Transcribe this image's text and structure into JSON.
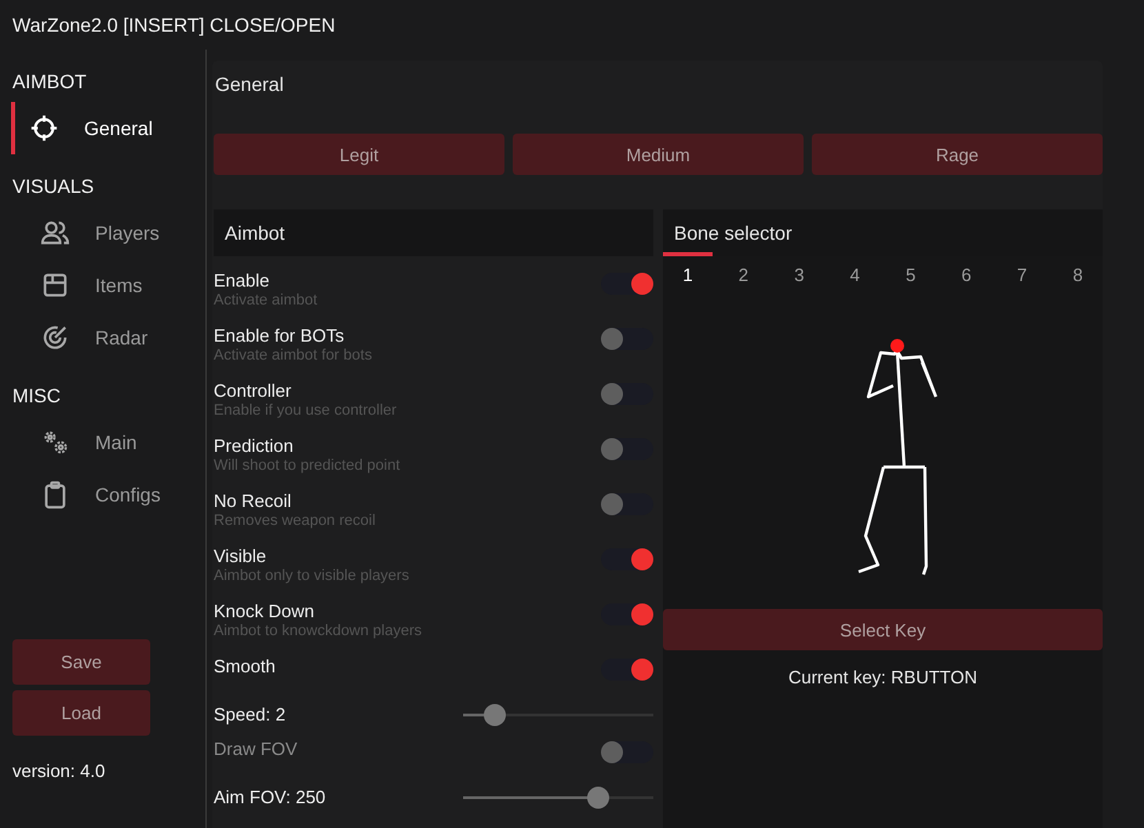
{
  "window": {
    "title": "WarZone2.0 [INSERT] CLOSE/OPEN"
  },
  "sidebar": {
    "sections": [
      {
        "heading": "AIMBOT",
        "items": [
          {
            "label": "General",
            "kind": "crosshair",
            "selected": true
          }
        ]
      },
      {
        "heading": "VISUALS",
        "items": [
          {
            "label": "Players",
            "kind": "users",
            "selected": false
          },
          {
            "label": "Items",
            "kind": "box",
            "selected": false
          },
          {
            "label": "Radar",
            "kind": "radar",
            "selected": false
          }
        ]
      },
      {
        "heading": "MISC",
        "items": [
          {
            "label": "Main",
            "kind": "gears",
            "selected": false
          },
          {
            "label": "Configs",
            "kind": "clipboard",
            "selected": false
          }
        ]
      }
    ],
    "buttons": [
      "Save",
      "Load"
    ],
    "version": "version: 4.0"
  },
  "page_title": "General",
  "presets": [
    "Legit",
    "Medium",
    "Rage"
  ],
  "aimbot": {
    "title": "Aimbot",
    "settings": [
      {
        "kind": "toggle",
        "label": "Enable",
        "description": "Activate aimbot",
        "on": true,
        "disabled": false
      },
      {
        "kind": "toggle",
        "label": "Enable for BOTs",
        "description": "Activate aimbot for bots",
        "on": false,
        "disabled": false
      },
      {
        "kind": "toggle",
        "label": "Controller",
        "description": "Enable if you use controller",
        "on": false,
        "disabled": false
      },
      {
        "kind": "toggle",
        "label": "Prediction",
        "description": "Will shoot to predicted point",
        "on": false,
        "disabled": false
      },
      {
        "kind": "toggle",
        "label": "No Recoil",
        "description": "Removes weapon recoil",
        "on": false,
        "disabled": false
      },
      {
        "kind": "toggle",
        "label": "Visible",
        "description": "Aimbot only to visible players",
        "on": true,
        "disabled": false
      },
      {
        "kind": "toggle",
        "label": "Knock Down",
        "description": "Aimbot to knowckdown players",
        "on": true,
        "disabled": false
      },
      {
        "kind": "toggle",
        "label": "Smooth",
        "on": true,
        "disabled": false
      },
      {
        "kind": "slider",
        "label": "Speed: 2",
        "level": 0.17
      },
      {
        "kind": "toggle",
        "label": "Draw FOV",
        "on": false,
        "disabled": true
      },
      {
        "kind": "slider",
        "label": "Aim FOV: 250",
        "level": 0.71
      }
    ]
  },
  "bone_selector": {
    "title": "Bone selector",
    "tabs": [
      {
        "label": "1",
        "selected": true
      },
      {
        "label": "2",
        "selected": false
      },
      {
        "label": "3",
        "selected": false
      },
      {
        "label": "4",
        "selected": false
      },
      {
        "label": "5",
        "selected": false
      },
      {
        "label": "6",
        "selected": false
      },
      {
        "label": "7",
        "selected": false
      },
      {
        "label": "8",
        "selected": false
      }
    ],
    "select_key_button": "Select Key",
    "current_key": "Current key: RBUTTON"
  }
}
